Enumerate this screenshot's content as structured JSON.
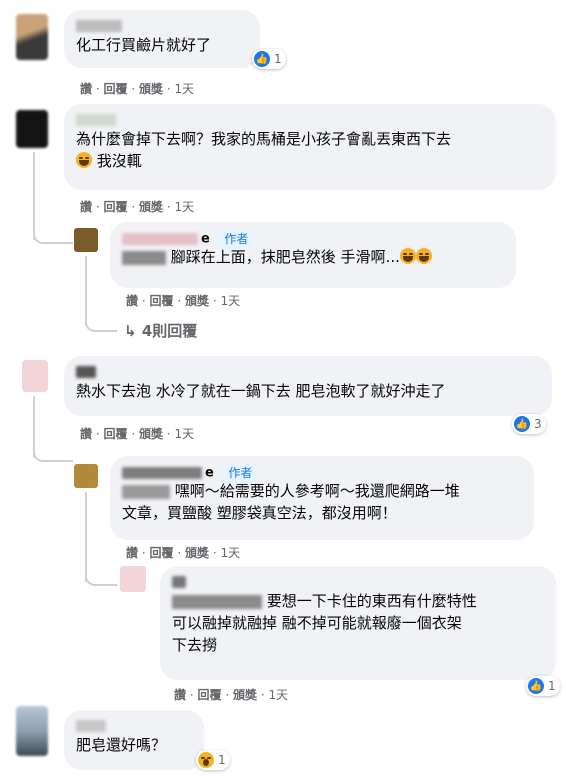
{
  "comments": [
    {
      "text_lines": [
        "化工行買鹼片就好了"
      ],
      "actions": [
        "讚",
        "回覆",
        "頒獎",
        "1天"
      ],
      "reaction_count": "1"
    },
    {
      "text_lines": [
        "為什麼會掉下去啊？我家的馬桶是小孩子會亂丟東西下去",
        "我沒輒"
      ],
      "actions": [
        "讚",
        "回覆",
        "頒獎",
        "1天"
      ],
      "reply": {
        "badge": "作者",
        "name_suffix": "e",
        "text_lines": [
          "腳踩在上面，抹肥皂然後 手滑啊..."
        ],
        "actions": [
          "讚",
          "回覆",
          "頒獎",
          "1天"
        ]
      },
      "more_replies": "4則回覆"
    },
    {
      "text_lines": [
        "熱水下去泡 水冷了就在一鍋下去 肥皂泡軟了就好沖走了"
      ],
      "actions": [
        "讚",
        "回覆",
        "頒獎",
        "1天"
      ],
      "reaction_count": "3",
      "reply": {
        "badge": "作者",
        "name_suffix": "e",
        "text_lines": [
          "嘿啊～給需要的人參考啊～我還爬網路一堆",
          "文章，買鹽酸 塑膠袋真空法，都沒用啊！"
        ],
        "actions": [
          "讚",
          "回覆",
          "頒獎",
          "1天"
        ]
      },
      "reply2": {
        "text_lines": [
          "要想一下卡住的東西有什麼特性",
          "可以融掉就融掉 融不掉可能就報廢一個衣架",
          "下去撈"
        ],
        "actions": [
          "讚",
          "回覆",
          "頒獎",
          "1天"
        ],
        "reaction_count": "1"
      }
    },
    {
      "text_lines": [
        "肥皂還好嗎？"
      ],
      "reaction_count": "1"
    }
  ],
  "separator": "·",
  "icons": {
    "like": "thumbs-up-icon",
    "laugh": "laughing-emoji-icon",
    "wow": "wow-emoji-icon",
    "reply_arrow": "reply-arrow-icon"
  },
  "colors": {
    "link_blue": "#1877f2",
    "bubble_gray": "#f0f2f5",
    "meta_gray": "#65676b"
  }
}
